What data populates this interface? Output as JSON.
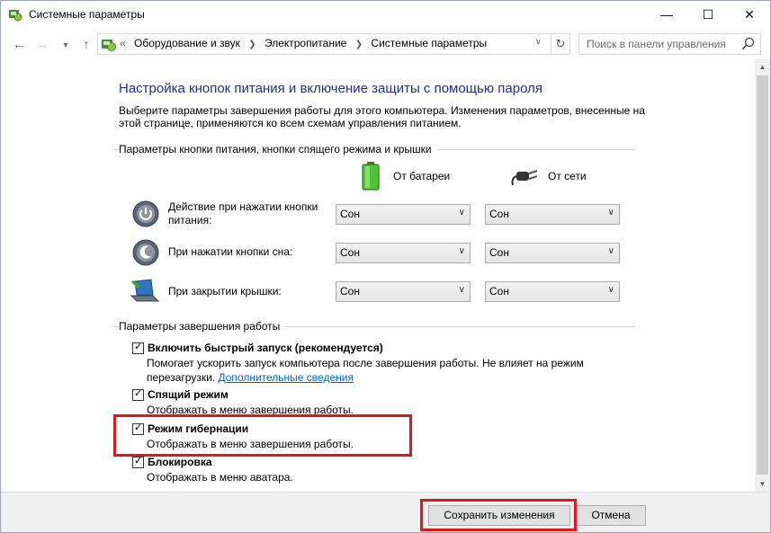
{
  "window": {
    "title": "Системные параметры",
    "min_icon": "minimize-icon",
    "max_icon": "maximize-icon",
    "close_icon": "close-icon"
  },
  "address": {
    "prefix": "«",
    "crumbs": [
      "Оборудование и звук",
      "Электропитание",
      "Системные параметры"
    ],
    "search_placeholder": "Поиск в панели управления"
  },
  "page": {
    "heading": "Настройка кнопок питания и включение защиты с помощью пароля",
    "description": "Выберите параметры завершения работы для этого компьютера. Изменения параметров, внесенные на этой странице, применяются ко всем схемам управления питанием."
  },
  "power_buttons": {
    "section_title": "Параметры кнопки питания, кнопки спящего режима и крышки",
    "col_battery": "От батареи",
    "col_ac": "От сети",
    "rows": [
      {
        "label": "Действие при нажатии кнопки питания:",
        "battery": "Сон",
        "ac": "Сон",
        "icon": "power-button-icon"
      },
      {
        "label": "При нажатии кнопки сна:",
        "battery": "Сон",
        "ac": "Сон",
        "icon": "sleep-button-icon"
      },
      {
        "label": "При закрытии крышки:",
        "battery": "Сон",
        "ac": "Сон",
        "icon": "laptop-lid-icon"
      }
    ]
  },
  "shutdown": {
    "section_title": "Параметры завершения работы",
    "items": [
      {
        "label": "Включить быстрый запуск (рекомендуется)",
        "checked": true,
        "desc": "Помогает ускорить запуск компьютера после завершения работы. Не влияет на режим перезагрузки.",
        "link": "Дополнительные сведения"
      },
      {
        "label": "Спящий режим",
        "checked": true,
        "desc": "Отображать в меню завершения работы."
      },
      {
        "label": "Режим гибернации",
        "checked": true,
        "desc": "Отображать в меню завершения работы."
      },
      {
        "label": "Блокировка",
        "checked": true,
        "desc": "Отображать в меню аватара."
      }
    ]
  },
  "footer": {
    "save_label": "Сохранить изменения",
    "cancel_label": "Отмена"
  },
  "colors": {
    "heading": "#1e3287",
    "highlight": "#d9191c",
    "link": "#0066cc"
  }
}
